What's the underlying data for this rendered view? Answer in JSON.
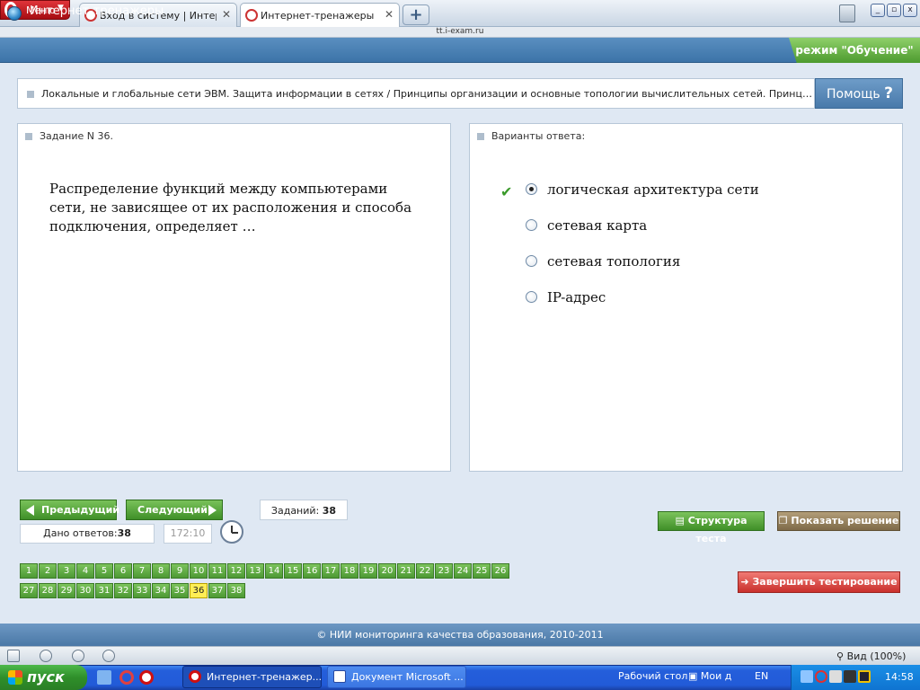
{
  "browser": {
    "menu_label": "Меню",
    "tabs": [
      {
        "label": "Вход в систему | Интер...",
        "active": false
      },
      {
        "label": "Интернет-тренажеры",
        "active": true
      }
    ],
    "new_tab_symbol": "+",
    "address": "tt.i-exam.ru",
    "window_buttons": [
      "_",
      "▫",
      "x"
    ]
  },
  "app": {
    "title": "Интернет-тренажеры",
    "mode": "режим \"Обучение\"",
    "topic": "Локальные и глобальные сети ЭВМ. Защита информации в сетях / Принципы организации и основные топологии вычислительных сетей. Принципы ...",
    "help_label": "Помощь",
    "help_symbol": "?"
  },
  "task": {
    "header": "Задание N 36.",
    "question": "Распределение функций между компьютерами сети, не зависящее от их расположения и способа подключения, определяет …"
  },
  "answers": {
    "header": "Варианты ответа:",
    "options": [
      {
        "text": "логическая архитектура сети",
        "selected": true,
        "correct": true
      },
      {
        "text": "сетевая карта",
        "selected": false,
        "correct": false
      },
      {
        "text": "сетевая топология",
        "selected": false,
        "correct": false
      },
      {
        "text": "IP-адрес",
        "selected": false,
        "correct": false
      }
    ]
  },
  "controls": {
    "prev_label": "Предыдущий",
    "next_label": "Следующий",
    "tasks_label": "Заданий:",
    "tasks_count": "38",
    "answered_label": "Дано ответов:",
    "answered_count": "38",
    "timer": "172:10",
    "structure_label": "Структура теста",
    "show_solution_label": "Показать решение",
    "finish_label": "Завершить тестирование"
  },
  "task_numbers": {
    "row1": [
      "1",
      "2",
      "3",
      "4",
      "5",
      "6",
      "7",
      "8",
      "9",
      "10",
      "11",
      "12",
      "13",
      "14",
      "15",
      "16",
      "17",
      "18",
      "19",
      "20",
      "21",
      "22",
      "23",
      "24",
      "25",
      "26"
    ],
    "row2": [
      "27",
      "28",
      "29",
      "30",
      "31",
      "32",
      "33",
      "34",
      "35",
      "36",
      "37",
      "38"
    ],
    "current": "36"
  },
  "footer": {
    "copyright": "© НИИ мониторинга качества образования, 2010-2011"
  },
  "statusbar": {
    "zoom": "Вид (100%)"
  },
  "taskbar": {
    "start_label": "пуск",
    "windows": [
      {
        "label": "Интернет-тренажер...",
        "active": true
      },
      {
        "label": "Документ Microsoft ...",
        "active": false
      }
    ],
    "desktop_label": "Рабочий стол",
    "my_docs_label": "Мои д",
    "lang": "EN",
    "time": "14:58"
  },
  "colors": {
    "header_blue": "#4a7fb3",
    "green_button": "#4d9934",
    "red_button": "#d8403a",
    "current_task": "#ffee55",
    "content_bg": "#dfe8f3"
  }
}
